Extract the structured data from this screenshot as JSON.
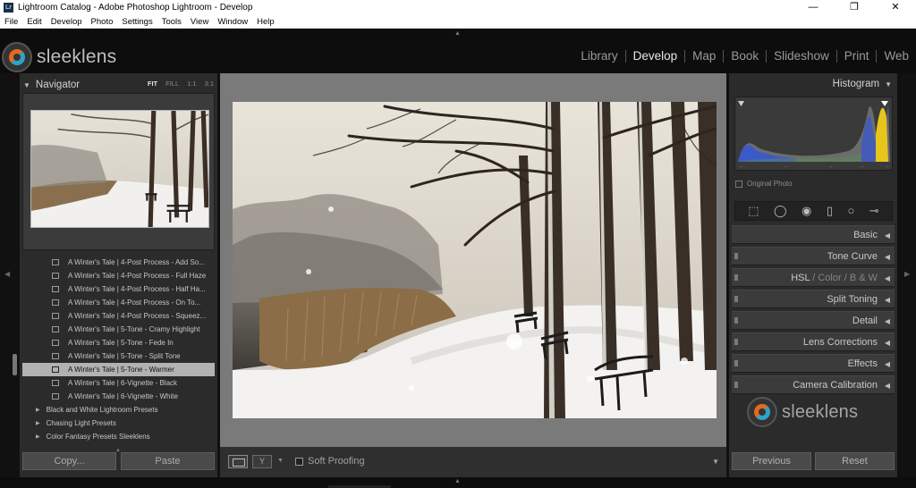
{
  "window": {
    "title": "Lightroom Catalog - Adobe Photoshop Lightroom - Develop",
    "app_icon": "Lr",
    "controls": [
      "—",
      "❐",
      "✕"
    ]
  },
  "menu": [
    "File",
    "Edit",
    "Develop",
    "Photo",
    "Settings",
    "Tools",
    "View",
    "Window",
    "Help"
  ],
  "identity_plate": "sleeklens",
  "modules": [
    {
      "label": "Library",
      "active": false
    },
    {
      "label": "Develop",
      "active": true
    },
    {
      "label": "Map",
      "active": false
    },
    {
      "label": "Book",
      "active": false
    },
    {
      "label": "Slideshow",
      "active": false
    },
    {
      "label": "Print",
      "active": false
    },
    {
      "label": "Web",
      "active": false
    }
  ],
  "navigator": {
    "title": "Navigator",
    "zoom": [
      "FIT",
      "FILL",
      "1:1",
      "3:1"
    ]
  },
  "presets": [
    {
      "label": "A Winter's Tale | 4-Post Process - Add So...",
      "kind": "sub"
    },
    {
      "label": "A Winter's Tale | 4-Post Process - Full Haze",
      "kind": "sub"
    },
    {
      "label": "A Winter's Tale | 4-Post Process - Half Ha...",
      "kind": "sub"
    },
    {
      "label": "A Winter's Tale | 4-Post Process - On To...",
      "kind": "sub"
    },
    {
      "label": "A Winter's Tale | 4-Post Process - Squeez...",
      "kind": "sub"
    },
    {
      "label": "A Winter's Tale | 5-Tone - Cramy Highlight",
      "kind": "sub"
    },
    {
      "label": "A Winter's Tale | 5-Tone - Fede In",
      "kind": "sub"
    },
    {
      "label": "A Winter's Tale | 5-Tone - Split Tone",
      "kind": "sub"
    },
    {
      "label": "A Winter's Tale | 5-Tone - Warmer",
      "kind": "selected"
    },
    {
      "label": "A Winter's Tale | 6-Vignette - Black",
      "kind": "sub"
    },
    {
      "label": "A Winter's Tale | 6-Vignette - White",
      "kind": "sub"
    },
    {
      "label": "Black and White Lightroom Presets",
      "kind": "folder"
    },
    {
      "label": "Chasing Light Presets",
      "kind": "folder"
    },
    {
      "label": "Color Fantasy Presets Sleeklens",
      "kind": "folder"
    }
  ],
  "left_buttons": {
    "copy": "Copy...",
    "paste": "Paste"
  },
  "toolbar": {
    "soft_proofing": "Soft Proofing"
  },
  "histogram": {
    "title": "Histogram",
    "original_photo": "Original Photo"
  },
  "sections": [
    {
      "label": "Basic"
    },
    {
      "label": "Tone Curve"
    },
    {
      "label": "HSL",
      "extra": [
        "Color",
        "B & W"
      ]
    },
    {
      "label": "Split Toning"
    },
    {
      "label": "Detail"
    },
    {
      "label": "Lens Corrections"
    },
    {
      "label": "Effects"
    },
    {
      "label": "Camera Calibration"
    }
  ],
  "right_buttons": {
    "previous": "Previous",
    "reset": "Reset"
  },
  "colors": {
    "accent_orange": "#e26a1f",
    "accent_blue": "#2ea3c9",
    "panel_bg": "#2b2b2b",
    "center_bg": "#7a7a7a"
  }
}
